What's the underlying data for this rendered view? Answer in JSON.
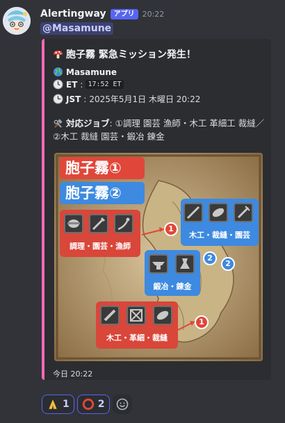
{
  "message": {
    "author": "Alertingway",
    "badge": "アプリ",
    "time": "20:22",
    "mention": "@Masamune"
  },
  "embed": {
    "accent_color": "#ff69b4",
    "title": "胞子霧 緊急ミッション発生！",
    "title_icon": "mushroom-icon",
    "world_icon": "globe-icon",
    "world": "Masamune",
    "et_label": "ET",
    "et_value": "17:52 ET",
    "jst_label": "JST",
    "jst_value": "2025年5月1日 木曜日 20:22",
    "jobs_label": "対応ジョブ",
    "jobs_value": ": ①調理 園芸 漁師・木工 革細工 裁縫／②木工 裁縫 園芸・鍛冶 錬金",
    "footer": "今日 20:22"
  },
  "map": {
    "legend1": "胞子霧①",
    "legend2": "胞子霧②",
    "group_a_label": "調理・園芸・漁師",
    "group_b_label": "木工・裁縫・園芸",
    "group_c_label": "鍛冶・錬金",
    "group_d_label": "木工・革細・裁縫",
    "marker_1": "1",
    "marker_2": "2",
    "red": "#e0473a",
    "blue": "#3d8ae0"
  },
  "reactions": [
    {
      "icon": "folded-hands-icon",
      "count": "1"
    },
    {
      "icon": "red-circle-icon",
      "count": "2"
    }
  ]
}
